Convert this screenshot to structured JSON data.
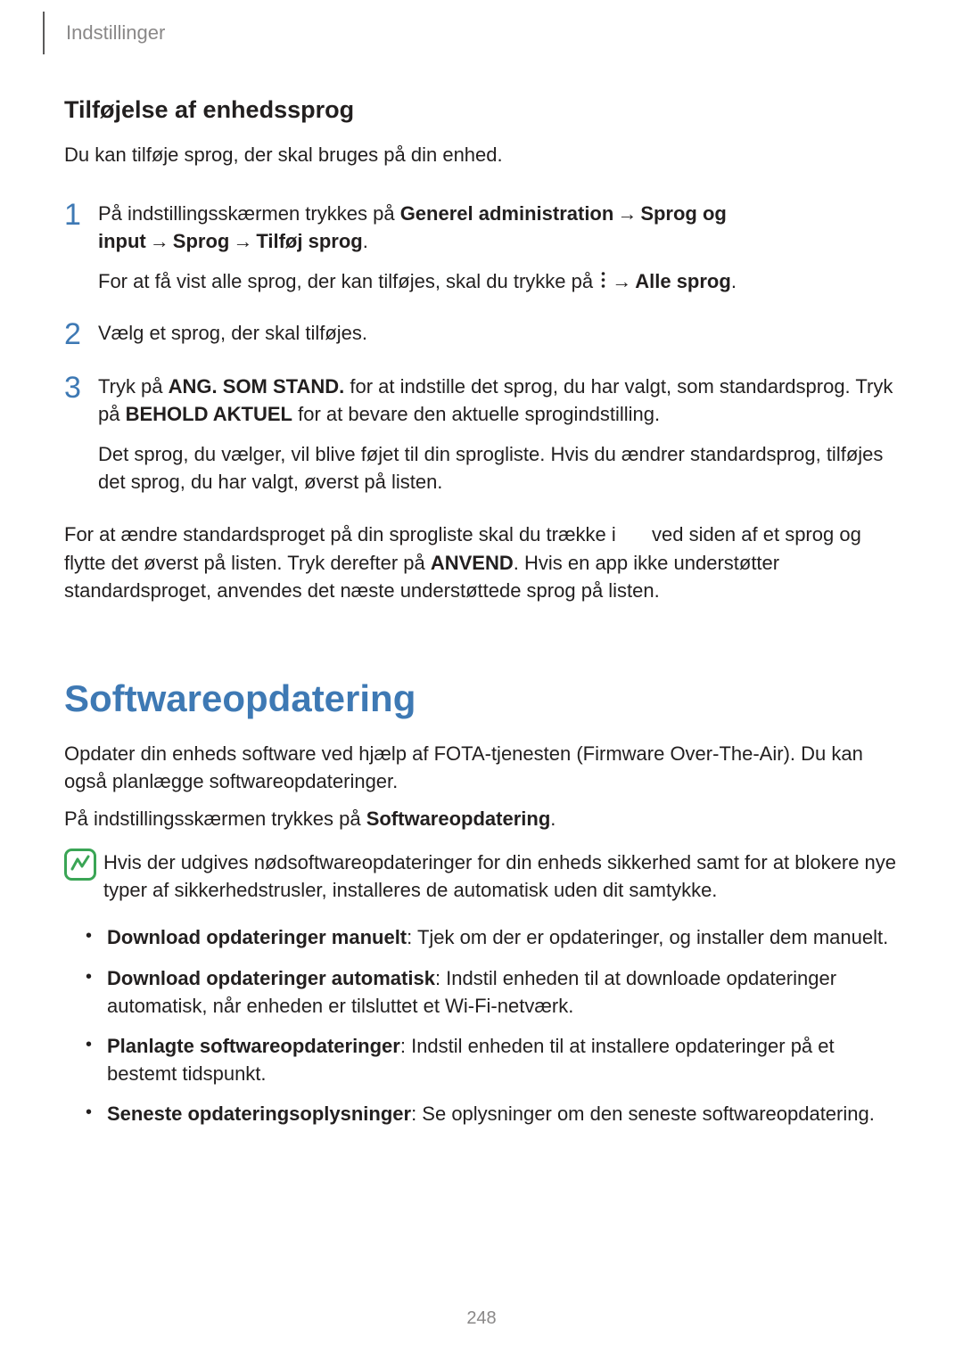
{
  "header": {
    "section": "Indstillinger"
  },
  "sub1": {
    "title": "Tilføjelse af enhedssprog",
    "lead": "Du kan tilføje sprog, der skal bruges på din enhed.",
    "steps": {
      "s1": {
        "num": "1",
        "p1a": "På indstillingsskærmen trykkes på ",
        "p1b": "Generel administration",
        "p1c": "Sprog og input",
        "p1d": "Sprog",
        "p1e": "Tilføj sprog",
        "p1f": ".",
        "p2a": "For at få vist alle sprog, der kan tilføjes, skal du trykke på ",
        "p2b": "Alle sprog",
        "p2c": "."
      },
      "s2": {
        "num": "2",
        "p1": "Vælg et sprog, der skal tilføjes."
      },
      "s3": {
        "num": "3",
        "p1a": "Tryk på ",
        "p1b": "ANG. SOM STAND.",
        "p1c": " for at indstille det sprog, du har valgt, som standardsprog. Tryk på ",
        "p1d": "BEHOLD AKTUEL",
        "p1e": " for at bevare den aktuelle sprogindstilling.",
        "p2": "Det sprog, du vælger, vil blive føjet til din sprogliste. Hvis du ændrer standardsprog, tilføjes det sprog, du har valgt, øverst på listen."
      }
    },
    "closing_a": "For at ændre standardsproget på din sprogliste skal du trække i ",
    "closing_b": " ved siden af et sprog og flytte det øverst på listen. Tryk derefter på ",
    "closing_c": "ANVEND",
    "closing_d": ". Hvis en app ikke understøtter standardsproget, anvendes det næste understøttede sprog på listen."
  },
  "sub2": {
    "title": "Softwareopdatering",
    "p1": "Opdater din enheds software ved hjælp af FOTA-tjenesten (Firmware Over-The-Air). Du kan også planlægge softwareopdateringer.",
    "p2a": "På indstillingsskærmen trykkes på ",
    "p2b": "Softwareopdatering",
    "p2c": ".",
    "note": "Hvis der udgives nødsoftwareopdateringer for din enheds sikkerhed samt for at blokere nye typer af sikkerhedstrusler, installeres de automatisk uden dit samtykke.",
    "bullets": {
      "b1a": "Download opdateringer manuelt",
      "b1b": ": Tjek om der er opdateringer, og installer dem manuelt.",
      "b2a": "Download opdateringer automatisk",
      "b2b": ": Indstil enheden til at downloade opdateringer automatisk, når enheden er tilsluttet et Wi-Fi-netværk.",
      "b3a": "Planlagte softwareopdateringer",
      "b3b": ": Indstil enheden til at installere opdateringer på et bestemt tidspunkt.",
      "b4a": "Seneste opdateringsoplysninger",
      "b4b": ": Se oplysninger om den seneste softwareopdatering."
    }
  },
  "arrow": "→",
  "page": "248"
}
